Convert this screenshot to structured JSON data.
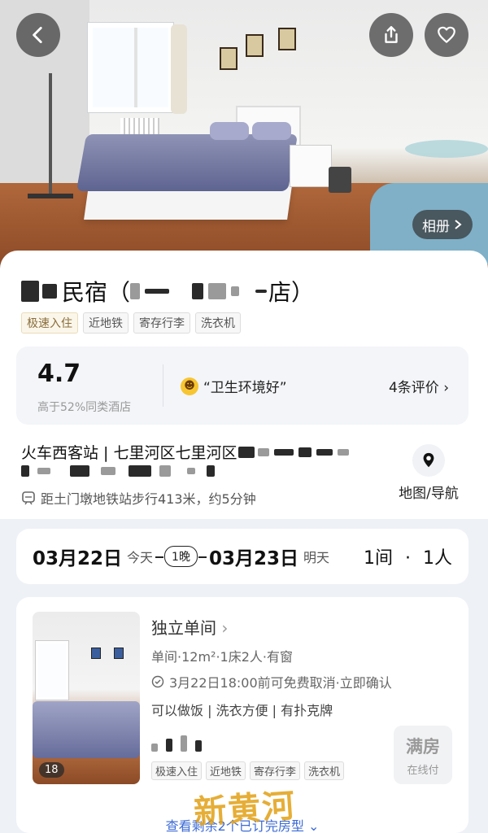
{
  "hero": {
    "album_label": "相册",
    "colors": {
      "overlay_button": "#3c3c3c"
    }
  },
  "hotel": {
    "name": "民宿",
    "name_paren_open": "（",
    "name_paren_close": "）",
    "name_suffix_visible": "店",
    "tags": [
      "极速入住",
      "近地铁",
      "寄存行李",
      "洗衣机"
    ]
  },
  "rating": {
    "score": "4.7",
    "subtext": "高于52%同类酒店",
    "highlight": "“卫生环境好”",
    "reviews_link": "4条评价"
  },
  "location": {
    "address": "火车西客站 | 七里河区七里河区",
    "metro": "距土门墩地铁站步行413米，约5分钟",
    "map_label": "地图/导航"
  },
  "dates": {
    "checkin_date": "03月22日",
    "checkin_label": "今天",
    "nights": "1晚",
    "checkout_date": "03月23日",
    "checkout_label": "明天",
    "rooms": "1间",
    "separator": "·",
    "guests": "1人"
  },
  "room": {
    "name": "独立单间",
    "spec": "单间·12m²·1床2人·有窗",
    "cancel": "3月22日18:00前可免费取消·立即确认",
    "features": "可以做饭 | 洗衣方便 | 有扑克牌",
    "photo_count": "18",
    "tags": [
      "极速入住",
      "近地铁",
      "寄存行李",
      "洗衣机"
    ],
    "status": "满房",
    "payment": "在线付",
    "more_link": "查看剩余2个已订完房型"
  },
  "watermark": "新黄河",
  "theme": {
    "accent": "#3c6bd6",
    "gold_tag": "#8a6d3b",
    "page_bg": "#eef1f6"
  }
}
